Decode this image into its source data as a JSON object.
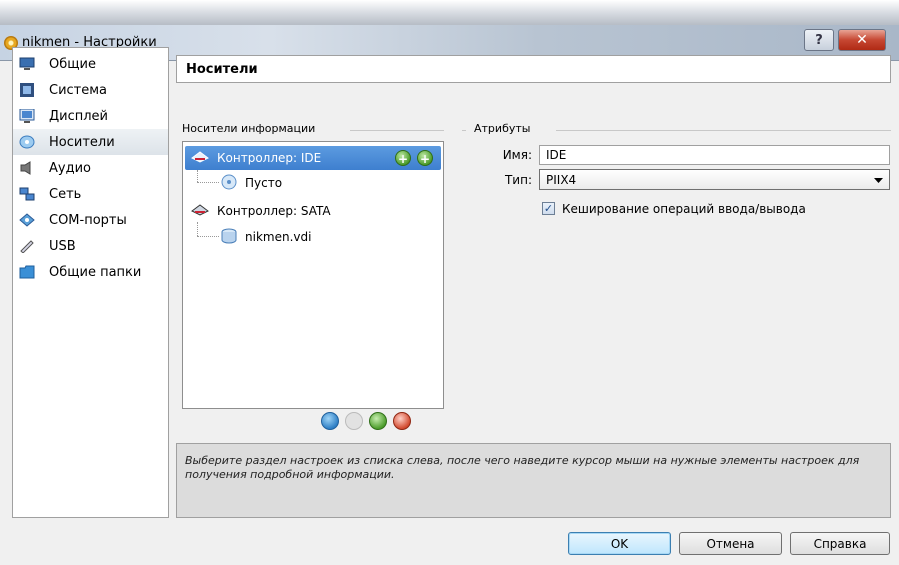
{
  "window": {
    "title": "nikmen - Настройки",
    "help_glyph": "?",
    "close_glyph": "✕"
  },
  "sidebar": {
    "items": [
      {
        "label": "Общие",
        "icon": "monitor-general-icon"
      },
      {
        "label": "Система",
        "icon": "chip-system-icon"
      },
      {
        "label": "Дисплей",
        "icon": "display-icon"
      },
      {
        "label": "Носители",
        "icon": "disk-storage-icon",
        "selected": true
      },
      {
        "label": "Аудио",
        "icon": "speaker-icon"
      },
      {
        "label": "Сеть",
        "icon": "network-icon"
      },
      {
        "label": "COM-порты",
        "icon": "serial-port-icon"
      },
      {
        "label": "USB",
        "icon": "usb-icon"
      },
      {
        "label": "Общие папки",
        "icon": "folder-icon"
      }
    ]
  },
  "page": {
    "title": "Носители"
  },
  "storage_tree": {
    "group_label": "Носители информации",
    "items": [
      {
        "label": "Контроллер: IDE",
        "icon": "ide-controller-icon",
        "selected": true
      },
      {
        "label": "Пусто",
        "icon": "optical-disc-icon"
      },
      {
        "label": "Контроллер: SATA",
        "icon": "sata-controller-icon"
      },
      {
        "label": "nikmen.vdi",
        "icon": "hard-disk-icon"
      }
    ],
    "add_glyph": "+"
  },
  "attributes": {
    "group_label": "Атрибуты",
    "name_label": "Имя:",
    "name_value": "IDE",
    "type_label": "Тип:",
    "type_value": "PIIX4",
    "cache_label": "Кеширование операций ввода/вывода",
    "cache_checked": true,
    "check_glyph": "✓"
  },
  "info": {
    "text": "Выберите раздел настроек из списка слева, после чего наведите курсор мыши на нужные элементы настроек для получения подробной информации."
  },
  "buttons": {
    "ok": "OK",
    "cancel": "Отмена",
    "help": "Справка"
  }
}
